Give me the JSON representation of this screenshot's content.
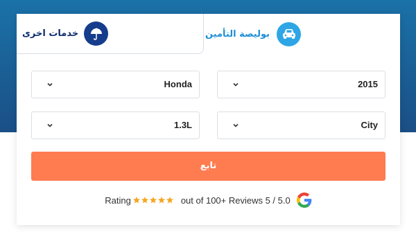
{
  "tabs": {
    "other_label": "خدمات اخرى",
    "insurance_label": "بوليصة التأمين"
  },
  "form": {
    "make": "Honda",
    "year": "2015",
    "engine": "1.3L",
    "model": "City",
    "submit_label": "تابع"
  },
  "rating": {
    "label": "Rating",
    "stars": 5,
    "reviews_text": "out of 100+ Reviews 5 / 5.0",
    "provider_icon": "google-icon"
  },
  "colors": {
    "accent": "#ff7b50",
    "header": "#1a5f95",
    "tab_dark": "#163c8c",
    "tab_light": "#2ea6e6",
    "star": "#f5a623"
  }
}
